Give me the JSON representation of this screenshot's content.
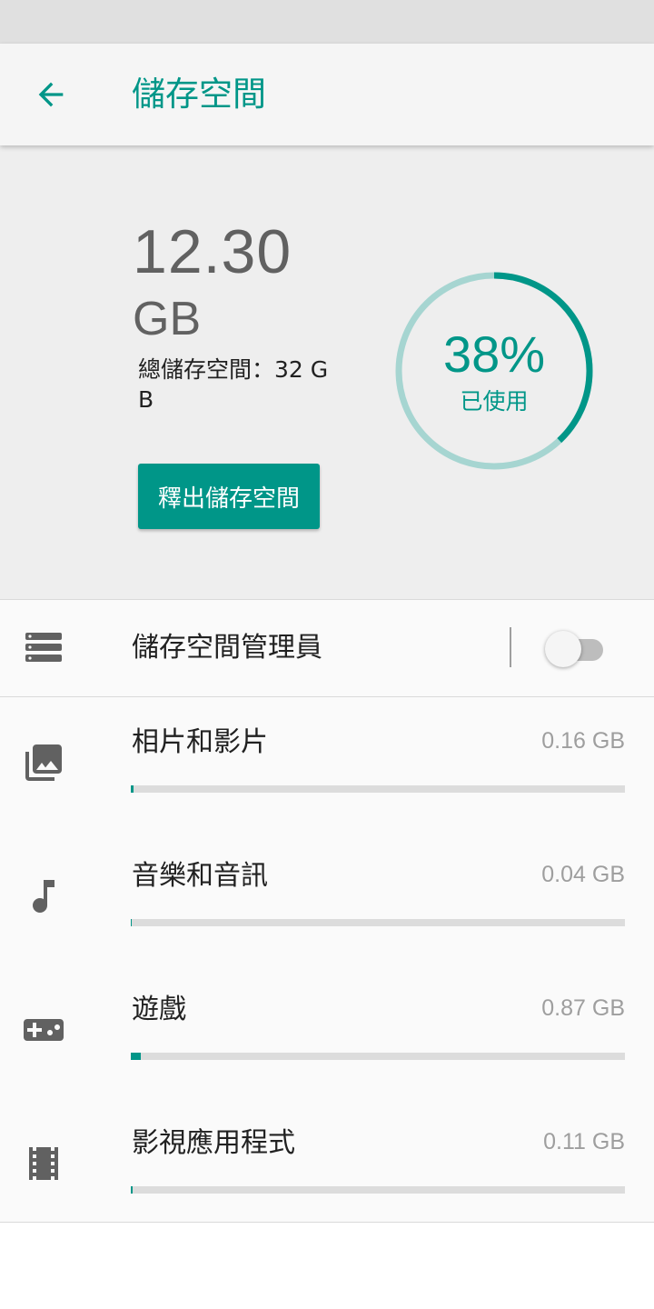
{
  "app_bar": {
    "title": "儲存空間"
  },
  "summary": {
    "used_value": "12.30",
    "used_unit": "GB",
    "total_text": "總儲存空間：32 GB",
    "free_up_button": "釋出儲存空間",
    "used_percent_text": "38%",
    "used_fraction": 0.38,
    "used_label": "已使用"
  },
  "storage_manager": {
    "label": "儲存空間管理員",
    "enabled": false
  },
  "categories": [
    {
      "label": "相片和影片",
      "size": "0.16 GB",
      "fraction": 0.005,
      "icon": "photo-library-icon"
    },
    {
      "label": "音樂和音訊",
      "size": "0.04 GB",
      "fraction": 0.0013,
      "icon": "music-note-icon"
    },
    {
      "label": "遊戲",
      "size": "0.87 GB",
      "fraction": 0.02,
      "icon": "gamepad-icon"
    },
    {
      "label": "影視應用程式",
      "size": "0.11 GB",
      "fraction": 0.0035,
      "icon": "movie-icon"
    }
  ],
  "colors": {
    "accent": "#009688",
    "gauge_track": "#a6d5d1",
    "text_primary": "#212121",
    "text_secondary": "#9e9e9e"
  }
}
